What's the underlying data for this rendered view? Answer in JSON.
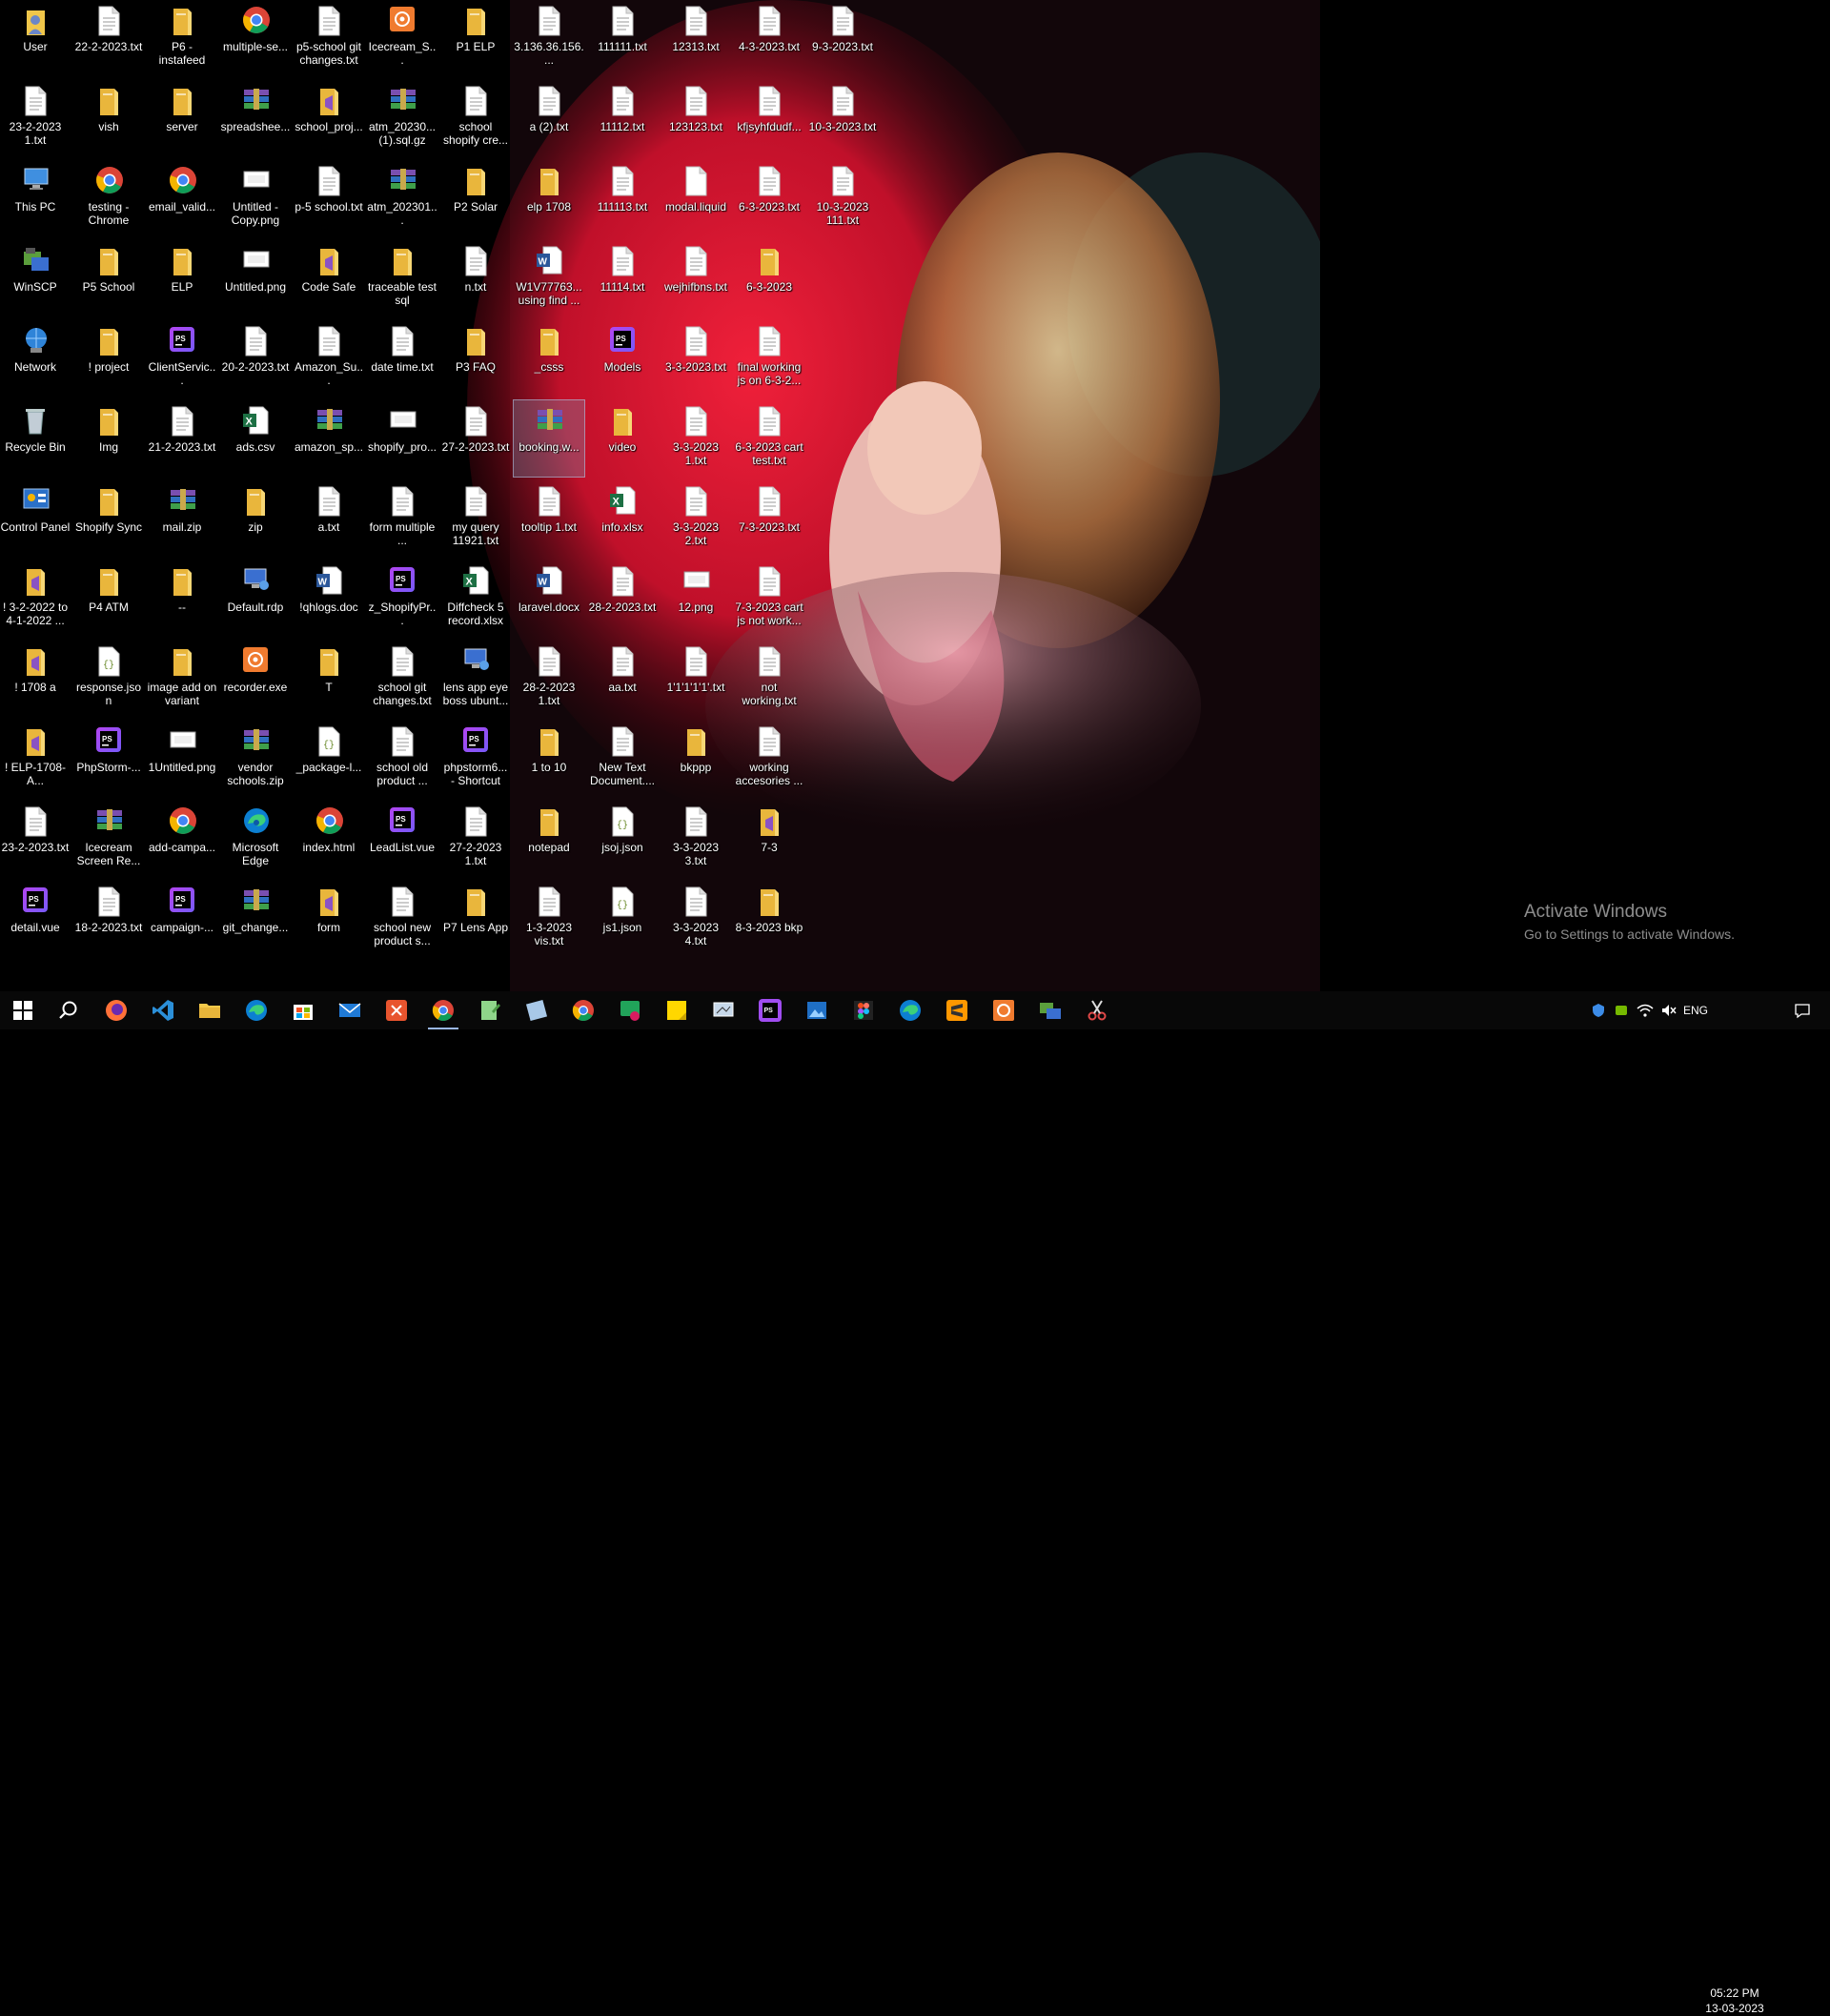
{
  "desktop": {
    "columns": [
      [
        {
          "label": "User",
          "icon": "user-folder"
        },
        {
          "label": "23-2-2023 1.txt",
          "icon": "text-file"
        },
        {
          "label": "This PC",
          "icon": "this-pc"
        },
        {
          "label": "WinSCP",
          "icon": "winscp"
        },
        {
          "label": "Network",
          "icon": "network"
        },
        {
          "label": "Recycle Bin",
          "icon": "recycle-bin"
        },
        {
          "label": "Control Panel",
          "icon": "control-panel"
        },
        {
          "label": "! 3-2-2022 to 4-1-2022 ...",
          "icon": "vs-folder"
        },
        {
          "label": "! 1708 a",
          "icon": "vs-folder"
        },
        {
          "label": "! ELP-1708-A...",
          "icon": "vs-folder"
        },
        {
          "label": "23-2-2023.txt",
          "icon": "text-file"
        },
        {
          "label": "detail.vue",
          "icon": "phpstorm"
        }
      ],
      [
        {
          "label": "22-2-2023.txt",
          "icon": "text-file"
        },
        {
          "label": "vish",
          "icon": "folder"
        },
        {
          "label": "testing - Chrome",
          "icon": "chrome"
        },
        {
          "label": "P5 School",
          "icon": "folder"
        },
        {
          "label": "! project",
          "icon": "folder"
        },
        {
          "label": "Img",
          "icon": "folder"
        },
        {
          "label": "Shopify Sync",
          "icon": "folder"
        },
        {
          "label": "P4 ATM",
          "icon": "folder"
        },
        {
          "label": "response.json",
          "icon": "json-file"
        },
        {
          "label": "PhpStorm-...",
          "icon": "phpstorm"
        },
        {
          "label": "Icecream Screen Re...",
          "icon": "archive"
        },
        {
          "label": "18-2-2023.txt",
          "icon": "text-file"
        }
      ],
      [
        {
          "label": "P6 - instafeed",
          "icon": "folder"
        },
        {
          "label": "server",
          "icon": "folder"
        },
        {
          "label": "email_valid...",
          "icon": "chrome"
        },
        {
          "label": "ELP",
          "icon": "folder"
        },
        {
          "label": "ClientServic...",
          "icon": "phpstorm"
        },
        {
          "label": "21-2-2023.txt",
          "icon": "text-file"
        },
        {
          "label": "mail.zip",
          "icon": "archive"
        },
        {
          "label": "--",
          "icon": "folder"
        },
        {
          "label": "image add on variant",
          "icon": "folder"
        },
        {
          "label": "1Untitled.png",
          "icon": "image-file"
        },
        {
          "label": "add-campa...",
          "icon": "chrome"
        },
        {
          "label": "campaign-...",
          "icon": "phpstorm"
        }
      ],
      [
        {
          "label": "multiple-se...",
          "icon": "chrome"
        },
        {
          "label": "spreadshee...",
          "icon": "archive"
        },
        {
          "label": "Untitled - Copy.png",
          "icon": "image-file"
        },
        {
          "label": "Untitled.png",
          "icon": "image-file"
        },
        {
          "label": "20-2-2023.txt",
          "icon": "text-file"
        },
        {
          "label": "ads.csv",
          "icon": "excel"
        },
        {
          "label": "zip",
          "icon": "folder"
        },
        {
          "label": "Default.rdp",
          "icon": "rdp"
        },
        {
          "label": "recorder.exe",
          "icon": "icecream"
        },
        {
          "label": "vendor schools.zip",
          "icon": "archive"
        },
        {
          "label": "Microsoft Edge",
          "icon": "edge"
        },
        {
          "label": "git_change...",
          "icon": "archive"
        }
      ],
      [
        {
          "label": "p5-school git changes.txt",
          "icon": "text-file"
        },
        {
          "label": "school_proj...",
          "icon": "vs-folder"
        },
        {
          "label": "p-5 school.txt",
          "icon": "text-file"
        },
        {
          "label": "Code Safe",
          "icon": "vs-folder"
        },
        {
          "label": "Amazon_Su...",
          "icon": "text-file"
        },
        {
          "label": "amazon_sp...",
          "icon": "archive"
        },
        {
          "label": "a.txt",
          "icon": "text-file"
        },
        {
          "label": "!qhlogs.doc",
          "icon": "word-doc"
        },
        {
          "label": "T",
          "icon": "folder"
        },
        {
          "label": "_package-l...",
          "icon": "json-file"
        },
        {
          "label": "index.html",
          "icon": "chrome"
        },
        {
          "label": "form",
          "icon": "vs-folder"
        }
      ],
      [
        {
          "label": "Icecream_S...",
          "icon": "icecream"
        },
        {
          "label": "atm_20230... (1).sql.gz",
          "icon": "archive"
        },
        {
          "label": "atm_202301...",
          "icon": "archive"
        },
        {
          "label": "traceable test sql",
          "icon": "folder"
        },
        {
          "label": "date time.txt",
          "icon": "text-file"
        },
        {
          "label": "shopify_pro...",
          "icon": "image-file"
        },
        {
          "label": "form multiple ...",
          "icon": "text-file"
        },
        {
          "label": "z_ShopifyPr...",
          "icon": "phpstorm"
        },
        {
          "label": "school git changes.txt",
          "icon": "text-file"
        },
        {
          "label": "school old product ...",
          "icon": "text-file"
        },
        {
          "label": "LeadList.vue",
          "icon": "phpstorm"
        },
        {
          "label": "school new product s...",
          "icon": "text-file"
        }
      ],
      [
        {
          "label": "P1 ELP",
          "icon": "folder"
        },
        {
          "label": "school shopify cre...",
          "icon": "text-file"
        },
        {
          "label": "P2 Solar",
          "icon": "folder"
        },
        {
          "label": "n.txt",
          "icon": "text-file"
        },
        {
          "label": "P3 FAQ",
          "icon": "folder"
        },
        {
          "label": "27-2-2023.txt",
          "icon": "text-file"
        },
        {
          "label": "my query 11921.txt",
          "icon": "text-file"
        },
        {
          "label": "Diffcheck 5 record.xlsx",
          "icon": "excel"
        },
        {
          "label": "lens app eye boss ubunt...",
          "icon": "rdp"
        },
        {
          "label": "phpstorm6... - Shortcut",
          "icon": "phpstorm"
        },
        {
          "label": "27-2-2023 1.txt",
          "icon": "text-file"
        },
        {
          "label": "P7 Lens App",
          "icon": "folder"
        }
      ],
      [
        {
          "label": "3.136.36.156....",
          "icon": "text-file"
        },
        {
          "label": "a (2).txt",
          "icon": "text-file"
        },
        {
          "label": "elp 1708",
          "icon": "folder"
        },
        {
          "label": "W1V77763... using find ...",
          "icon": "word-doc"
        },
        {
          "label": "_csss",
          "icon": "folder"
        },
        {
          "label": "booking.w...",
          "icon": "archive",
          "selected": true
        },
        {
          "label": "tooltip 1.txt",
          "icon": "text-file"
        },
        {
          "label": "laravel.docx",
          "icon": "word-doc"
        },
        {
          "label": "28-2-2023 1.txt",
          "icon": "text-file"
        },
        {
          "label": "1 to 10",
          "icon": "folder"
        },
        {
          "label": "notepad",
          "icon": "folder"
        },
        {
          "label": "1-3-2023 vis.txt",
          "icon": "text-file"
        }
      ],
      [
        {
          "label": "111111.txt",
          "icon": "text-file"
        },
        {
          "label": "11112.txt",
          "icon": "text-file"
        },
        {
          "label": "111113.txt",
          "icon": "text-file"
        },
        {
          "label": "11114.txt",
          "icon": "text-file"
        },
        {
          "label": "Models",
          "icon": "phpstorm"
        },
        {
          "label": "video",
          "icon": "folder"
        },
        {
          "label": "info.xlsx",
          "icon": "excel"
        },
        {
          "label": "28-2-2023.txt",
          "icon": "text-file"
        },
        {
          "label": "aa.txt",
          "icon": "text-file"
        },
        {
          "label": "New Text Document....",
          "icon": "text-file"
        },
        {
          "label": "jsoj.json",
          "icon": "json-file"
        },
        {
          "label": "js1.json",
          "icon": "json-file"
        }
      ],
      [
        {
          "label": "12313.txt",
          "icon": "text-file"
        },
        {
          "label": "123123.txt",
          "icon": "text-file"
        },
        {
          "label": "modal.liquid",
          "icon": "blank-file"
        },
        {
          "label": "wejhifbns.txt",
          "icon": "text-file"
        },
        {
          "label": "3-3-2023.txt",
          "icon": "text-file"
        },
        {
          "label": "3-3-2023 1.txt",
          "icon": "text-file"
        },
        {
          "label": "3-3-2023 2.txt",
          "icon": "text-file"
        },
        {
          "label": "12.png",
          "icon": "image-file"
        },
        {
          "label": "1'1'1'1'1'.txt",
          "icon": "text-file"
        },
        {
          "label": "bkppp",
          "icon": "folder"
        },
        {
          "label": "3-3-2023 3.txt",
          "icon": "text-file"
        },
        {
          "label": "3-3-2023 4.txt",
          "icon": "text-file"
        }
      ],
      [
        {
          "label": "4-3-2023.txt",
          "icon": "text-file"
        },
        {
          "label": "kfjsyhfdudf...",
          "icon": "text-file"
        },
        {
          "label": "6-3-2023.txt",
          "icon": "text-file"
        },
        {
          "label": "6-3-2023",
          "icon": "folder"
        },
        {
          "label": "final working js on 6-3-2...",
          "icon": "text-file"
        },
        {
          "label": "6-3-2023 cart test.txt",
          "icon": "text-file"
        },
        {
          "label": "7-3-2023.txt",
          "icon": "text-file"
        },
        {
          "label": "7-3-2023 cart js not work...",
          "icon": "text-file"
        },
        {
          "label": "not working.txt",
          "icon": "text-file"
        },
        {
          "label": "working accesories ...",
          "icon": "text-file"
        },
        {
          "label": "7-3",
          "icon": "vs-folder"
        },
        {
          "label": "8-3-2023 bkp",
          "icon": "folder"
        }
      ],
      [
        {
          "label": "9-3-2023.txt",
          "icon": "text-file"
        },
        {
          "label": "10-3-2023.txt",
          "icon": "text-file"
        },
        {
          "label": "10-3-2023 111.txt",
          "icon": "text-file"
        }
      ]
    ]
  },
  "watermark": {
    "title": "Activate Windows",
    "subtitle": "Go to Settings to activate Windows."
  },
  "taskbar": {
    "items": [
      {
        "name": "start-button",
        "icon": "windows-logo"
      },
      {
        "name": "search-button",
        "icon": "search-icon"
      },
      {
        "name": "firefox",
        "icon": "firefox-icon"
      },
      {
        "name": "vscode",
        "icon": "vscode-icon"
      },
      {
        "name": "file-explorer",
        "icon": "folder-icon"
      },
      {
        "name": "edge",
        "icon": "edge-icon"
      },
      {
        "name": "microsoft-store",
        "icon": "store-icon"
      },
      {
        "name": "mail",
        "icon": "mail-icon"
      },
      {
        "name": "app-orange",
        "icon": "orange-app-icon"
      },
      {
        "name": "chrome-active",
        "icon": "chrome-icon",
        "running": true
      },
      {
        "name": "notepad-plus",
        "icon": "notepad-icon"
      },
      {
        "name": "notepad",
        "icon": "notepad-blue-icon"
      },
      {
        "name": "chrome",
        "icon": "chrome-icon"
      },
      {
        "name": "whatsapp",
        "icon": "chat-icon"
      },
      {
        "name": "sticky-notes",
        "icon": "sticky-notes-icon"
      },
      {
        "name": "screen-sketch",
        "icon": "snip-icon"
      },
      {
        "name": "phpstorm",
        "icon": "phpstorm-icon"
      },
      {
        "name": "photos",
        "icon": "photos-icon"
      },
      {
        "name": "figma",
        "icon": "figma-icon"
      },
      {
        "name": "edge-blue",
        "icon": "edge-icon"
      },
      {
        "name": "sublime",
        "icon": "sublime-icon"
      },
      {
        "name": "icecream",
        "icon": "icecream-icon"
      },
      {
        "name": "winscp",
        "icon": "winscp-icon"
      },
      {
        "name": "snipping",
        "icon": "scissors-icon"
      }
    ],
    "tray": {
      "language": "ENG",
      "time": "05:22 PM",
      "date": "13-03-2023"
    }
  },
  "colors": {
    "accent": "#4a8df0",
    "folder": "#f3c94a",
    "taskbar": "#080808"
  }
}
